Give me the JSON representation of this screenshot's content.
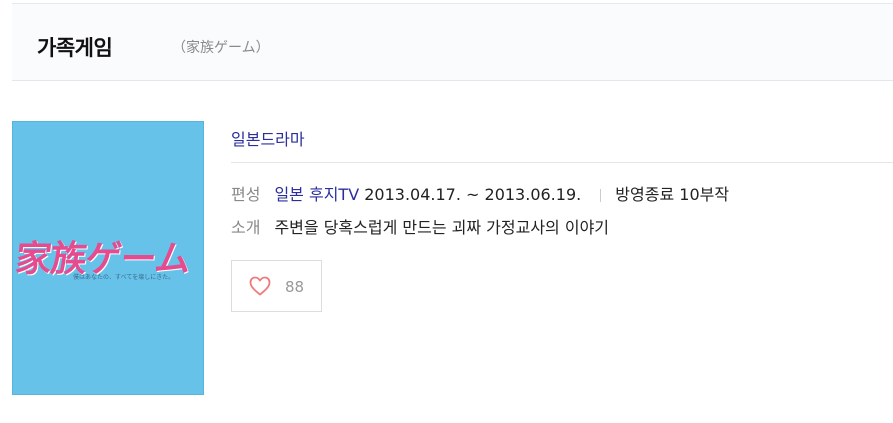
{
  "header": {
    "title": "가족게임",
    "subtitle": "（家族ゲーム）"
  },
  "poster": {
    "title_text": "家族ゲーム",
    "tagline_text": "僕はあなたの、すべてを壊しにきた。",
    "background_color": "#67c2ea",
    "title_color": "#e64a8f"
  },
  "info": {
    "genre": "일본드라마",
    "broadcast_label": "편성",
    "broadcaster": "일본 후지TV",
    "dates": "2013.04.17. ~ 2013.06.19.",
    "status": "방영종료 10부작",
    "intro_label": "소개",
    "intro": "주변을 당혹스럽게 만드는 괴짜 가정교사의 이야기"
  },
  "like": {
    "icon": "heart-outline-icon",
    "count": "88",
    "heart_color": "#f07a7a"
  }
}
